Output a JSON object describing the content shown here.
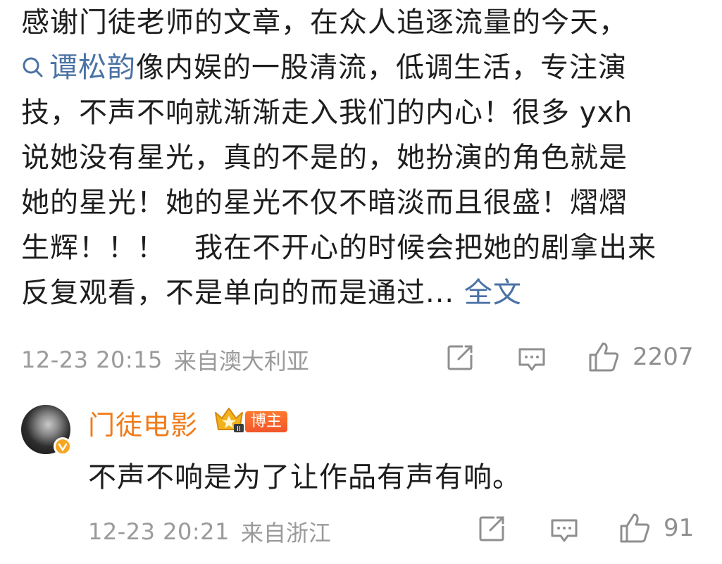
{
  "comment": {
    "line1": "感谢门徒老师的文章，在众人追逐流量的今天，",
    "topic": "谭松韵",
    "line2_rest": "像内娱的一股清流，低调生活，专注演",
    "line3": "技，不声不响就渐渐走入我们的内心！很多 yxh",
    "line4": "说她没有星光，真的不是的，她扮演的角色就是",
    "line5": "她的星光！她的星光不仅不暗淡而且很盛！熠熠",
    "line6": "生辉！！！   我在不开心的时候会把她的剧拿出来",
    "line7": "反复观看，不是单向的而是通过...",
    "full_text_link": "全文",
    "time": "12-23 20:15",
    "source": "来自澳大利亚",
    "like_count": "2207"
  },
  "reply": {
    "author": "门徒电影",
    "host_badge": "博主",
    "text": "不声不响是为了让作品有声有响。",
    "time": "12-23 20:21",
    "source": "来自浙江",
    "like_count": "91"
  },
  "colors": {
    "link": "#4a72a5",
    "author": "#f07b1a",
    "meta": "#9a9a9a",
    "badge": "#f2552a"
  }
}
